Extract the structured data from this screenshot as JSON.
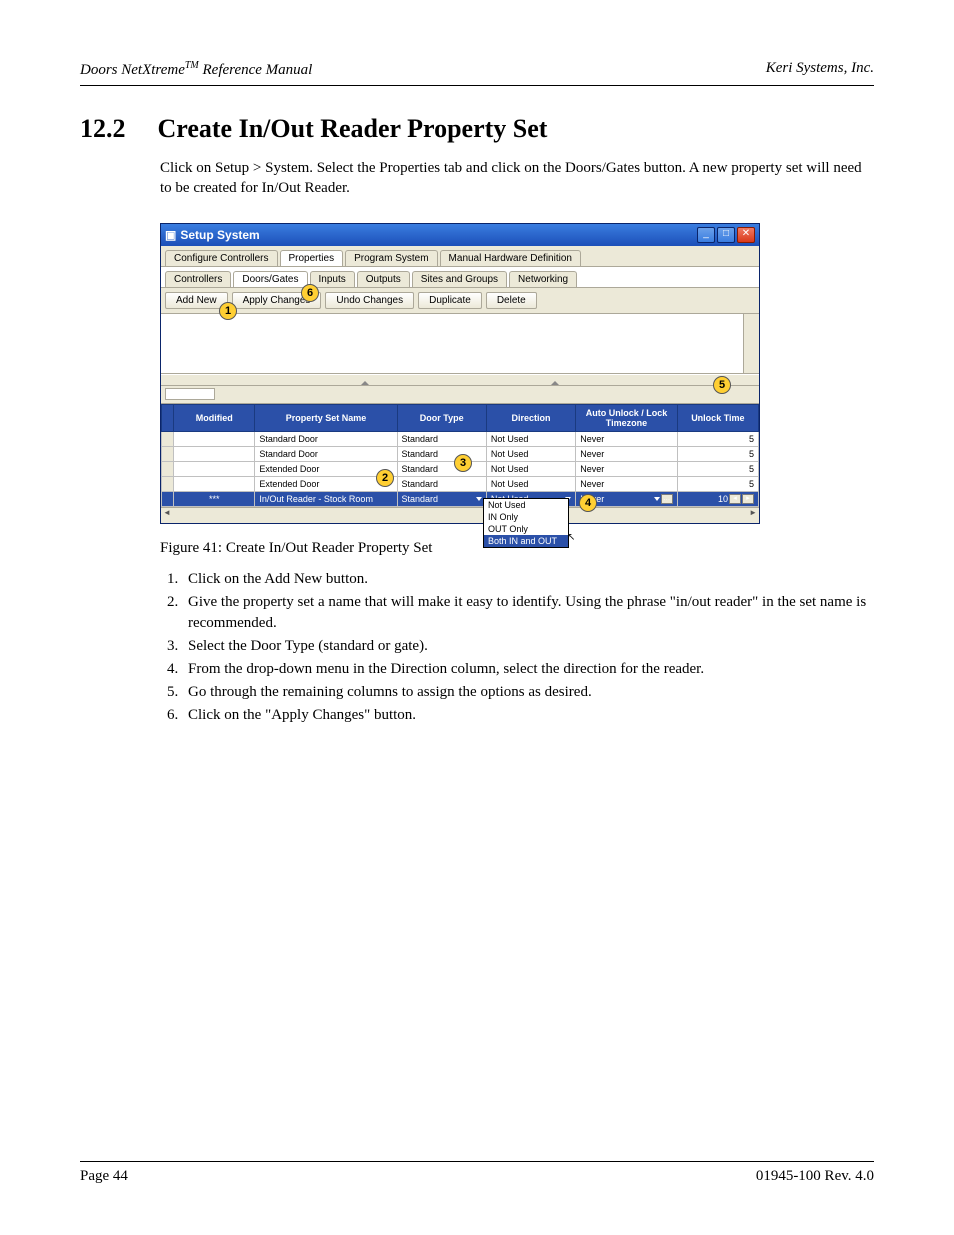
{
  "header": {
    "product": "Doors NetXtreme",
    "tm": "TM",
    "doc": "Reference Manual",
    "company": "Keri Systems, Inc."
  },
  "section": {
    "num": "12.2",
    "title": "Create In/Out Reader Property Set",
    "intro": "Click on Setup > System. Select the Properties tab and click on the Doors/Gates button. A new property set will need to be created for In/Out Reader."
  },
  "window": {
    "title": "Setup System",
    "tabs_top": [
      "Configure Controllers",
      "Properties",
      "Program System",
      "Manual Hardware Definition"
    ],
    "tabs_top_active": 1,
    "tabs_sub": [
      "Controllers",
      "Doors/Gates",
      "Inputs",
      "Outputs",
      "Sites and Groups",
      "Networking"
    ],
    "tabs_sub_active": 1,
    "toolbar": [
      "Add New",
      "Apply Changes",
      "Undo Changes",
      "Duplicate",
      "Delete"
    ],
    "columns": [
      "",
      "Modified",
      "Property Set Name",
      "Door Type",
      "Direction",
      "Auto Unlock / Lock Timezone",
      "Unlock Time"
    ],
    "rows": [
      {
        "mod": "",
        "name": "Standard Door",
        "door": "Standard",
        "dir": "Not Used",
        "tz": "Never",
        "ut": "5"
      },
      {
        "mod": "",
        "name": "Standard Door",
        "door": "Standard",
        "dir": "Not Used",
        "tz": "Never",
        "ut": "5"
      },
      {
        "mod": "",
        "name": "Extended Door",
        "door": "Standard",
        "dir": "Not Used",
        "tz": "Never",
        "ut": "5"
      },
      {
        "mod": "",
        "name": "Extended Door",
        "door": "Standard",
        "dir": "Not Used",
        "tz": "Never",
        "ut": "5"
      },
      {
        "mod": "***",
        "name": "In/Out Reader - Stock Room",
        "door": "Standard",
        "dir": "Not Used",
        "tz": "Never",
        "ut": "10",
        "selected": true
      }
    ],
    "dropdown": {
      "options": [
        "Not Used",
        "IN Only",
        "OUT Only",
        "Both IN and OUT"
      ],
      "selected_index": 3
    }
  },
  "callouts": {
    "c1": "1",
    "c2": "2",
    "c3": "3",
    "c4": "4",
    "c5": "5",
    "c6": "6"
  },
  "caption": "Figure 41: Create In/Out Reader Property Set",
  "steps": [
    "Click on the Add New button.",
    "Give the property set a name that will make it easy to identify. Using the phrase \"in/out reader\" in the set name is recommended.",
    "Select the Door Type (standard or gate).",
    "From the drop-down menu in the Direction column, select the direction for the reader.",
    "Go through the remaining columns to assign the options as desired.",
    "Click on the \"Apply Changes\" button."
  ],
  "footer": {
    "page": "Page 44",
    "docnum": "01945-100  Rev. 4.0"
  }
}
